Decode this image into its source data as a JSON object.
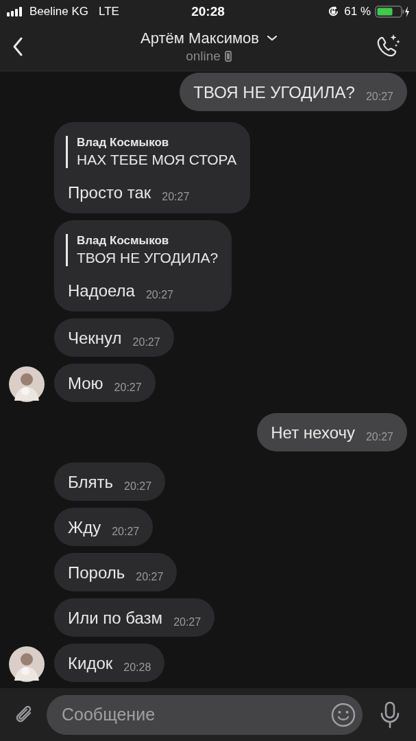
{
  "status_bar": {
    "carrier": "Beeline KG",
    "network": "LTE",
    "time": "20:28",
    "battery": "61 %"
  },
  "header": {
    "title": "Артём Максимов",
    "status": "online"
  },
  "messages": [
    {
      "kind": "out",
      "text": "ТВОЯ НЕ УГОДИЛА?",
      "time": "20:27"
    },
    {
      "kind": "in",
      "reply": {
        "author": "Влад Космыков",
        "text": "НАХ ТЕБЕ МОЯ СТОРА"
      },
      "text": "Просто так",
      "time": "20:27",
      "avatar": false
    },
    {
      "kind": "in",
      "reply": {
        "author": "Влад Космыков",
        "text": "ТВОЯ НЕ УГОДИЛА?"
      },
      "text": "Надоела",
      "time": "20:27",
      "avatar": false
    },
    {
      "kind": "in",
      "text": "Чекнул",
      "time": "20:27",
      "avatar": false
    },
    {
      "kind": "in",
      "text": "Мою",
      "time": "20:27",
      "avatar": true
    },
    {
      "kind": "out",
      "text": "Нет нехочу",
      "time": "20:27"
    },
    {
      "kind": "in",
      "text": "Блять",
      "time": "20:27",
      "avatar": false
    },
    {
      "kind": "in",
      "text": "Жду",
      "time": "20:27",
      "avatar": false
    },
    {
      "kind": "in",
      "text": "Пороль",
      "time": "20:27",
      "avatar": false
    },
    {
      "kind": "in",
      "text": "Или по базм",
      "time": "20:27",
      "avatar": false
    },
    {
      "kind": "in",
      "text": "Кидок",
      "time": "20:28",
      "avatar": true
    }
  ],
  "composer": {
    "placeholder": "Сообщение"
  }
}
